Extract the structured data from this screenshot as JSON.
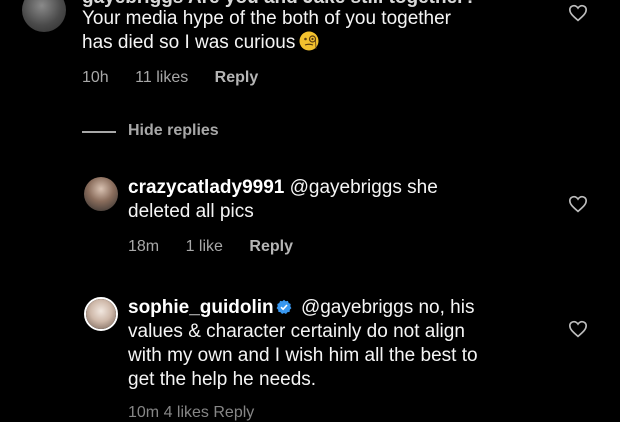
{
  "comment_top": {
    "partial_line": "gayebriggs Are you and Jake still together?",
    "line1": "Your media hype of the both of you together",
    "line2": "has died so I was curious",
    "emoji": "face-with-monocle",
    "time": "10h",
    "likes": "11 likes",
    "reply": "Reply"
  },
  "thread_toggle": {
    "label": "Hide replies"
  },
  "reply1": {
    "username": "crazycatlady9991",
    "mention": "@gayebriggs",
    "line1_rest": "she",
    "line2": "deleted all pics",
    "time": "18m",
    "likes": "1 like",
    "reply": "Reply"
  },
  "reply2": {
    "username": "sophie_guidolin",
    "mention": "@gayebriggs",
    "line1_rest": "no, his",
    "line2": "values & character certainly do not align",
    "line3": "with my own and I wish him all the best to",
    "line4": "get the help he needs.",
    "partial_meta": "10m 4 likes Reply"
  },
  "colors": {
    "background": "#000000",
    "text": "#f5f5f5",
    "muted": "#a8a8a8",
    "verified": "#3897f0"
  }
}
